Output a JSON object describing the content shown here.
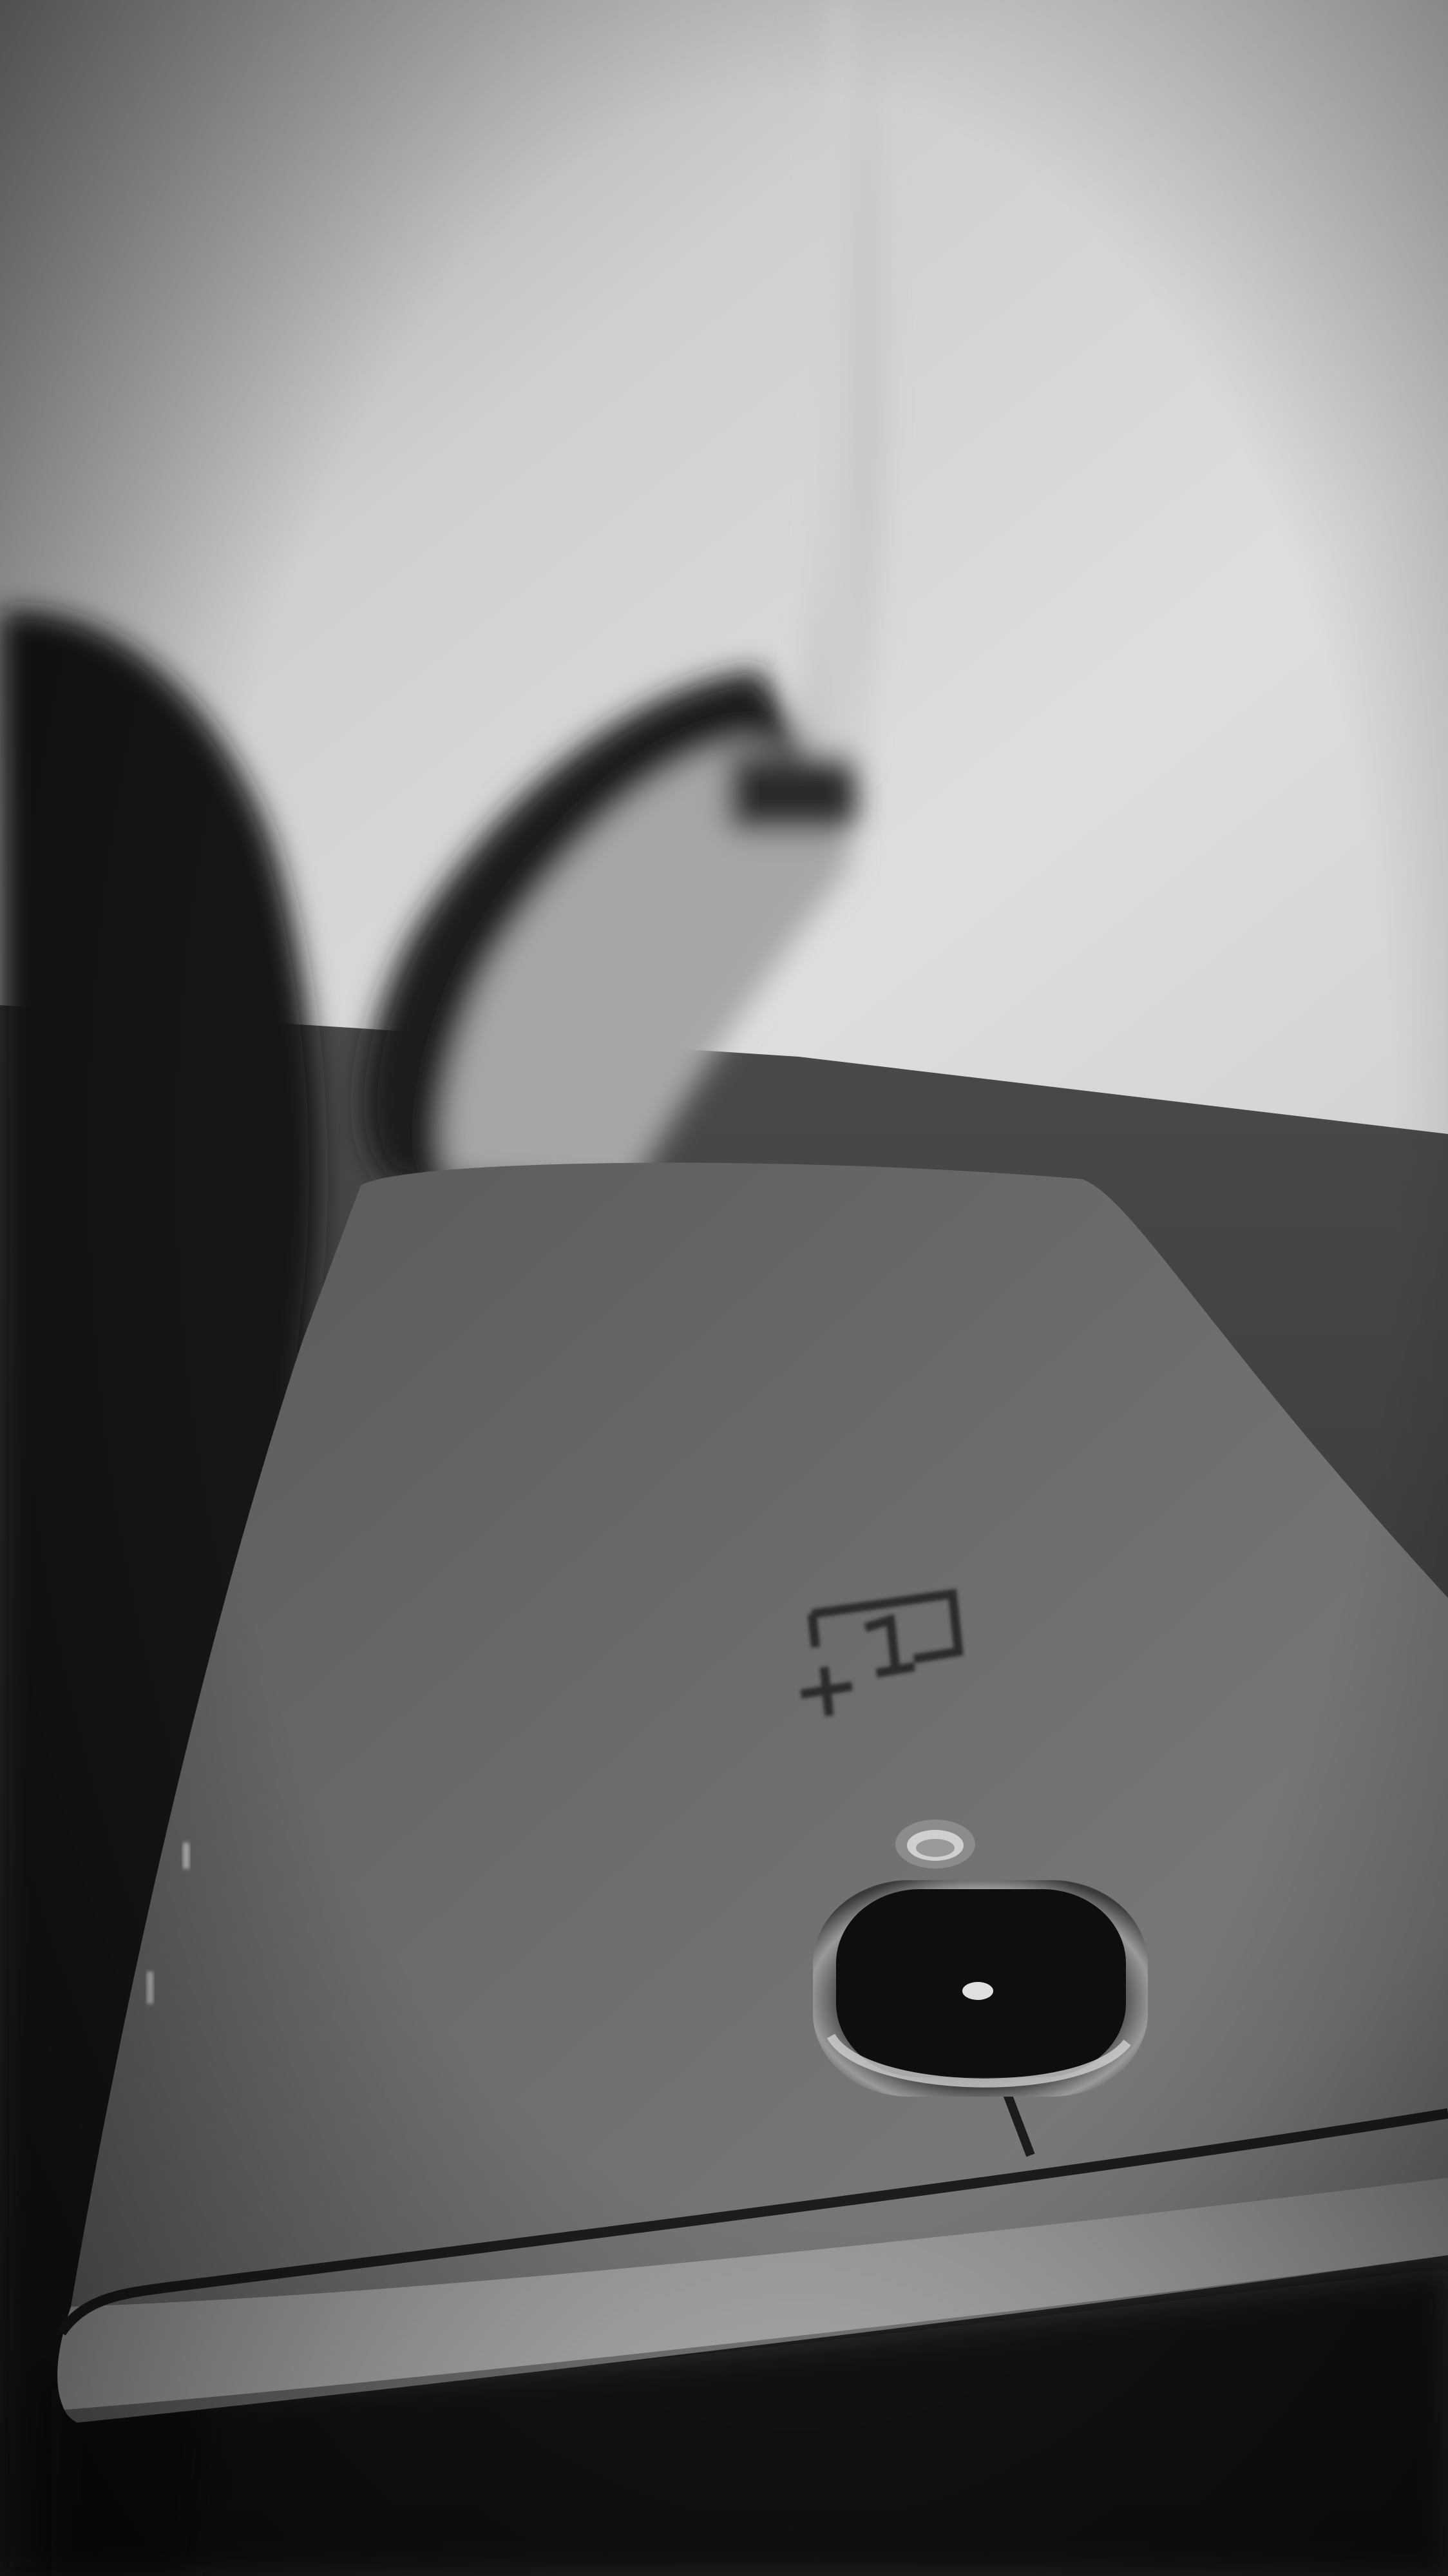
{
  "photo": {
    "style": "black-and-white",
    "subjects": [
      "headphones",
      "smartphone"
    ],
    "palette": {
      "wall_light": "#dcdcdc",
      "wall_shade": "#9e9e9e",
      "table": "#3e3e3e",
      "phone_body": "#7a7a7a",
      "phone_edge": "#a8a8a8",
      "antenna_line": "#1c1c1c",
      "headphone_dark": "#141414",
      "headphone_band": "#c4c4c4",
      "camera_lens": "#0e0e0e",
      "logo": "#2a2a2a"
    },
    "icons": [
      "oneplus-logo-icon",
      "camera-lens-icon",
      "flash-icon"
    ]
  }
}
